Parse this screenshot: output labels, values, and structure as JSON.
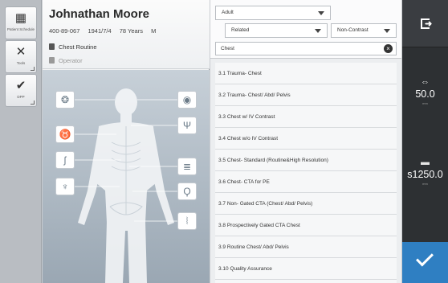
{
  "rail": {
    "items": [
      {
        "label": "Patient Schedule"
      },
      {
        "label": "Tools"
      },
      {
        "label": "DPP"
      }
    ]
  },
  "patient": {
    "name": "Johnathan Moore",
    "id": "400-89-067",
    "dob": "1941/7/4",
    "age": "78 Years",
    "sex": "M",
    "exam": "Chest Routine",
    "operator": "Operator"
  },
  "anatomy": {
    "regions": [
      "brain-icon",
      "lungs-icon",
      "abdomen-icon",
      "pelvis-icon",
      "eye-icon",
      "neck-spine-icon",
      "spine-icon",
      "pelvis-joint-icon",
      "leg-icon"
    ]
  },
  "filters": {
    "patient_type": "Adult",
    "relation": "Related",
    "contrast": "Non-Contrast",
    "search_value": "Chest"
  },
  "protocols": [
    "3.1 Trauma- Chest",
    "3.2 Trauma- Chest/ Abd/ Pelvis",
    "3.3 Chest w/ IV Contrast",
    "3.4 Chest w/o IV Contrast",
    "3.5 Chest- Standard (Routine&High Resolution)",
    "3.6 Chest- CTA for PE",
    "3.7 Non- Gated CTA  (Chest/ Abd/ Pelvis)",
    "3.8 Prospectively Gated CTA Chest",
    "3.9 Routine Chest/ Abd/ Pelvis",
    "3.10 Quality Assurance"
  ],
  "right_panel": {
    "metric1_value": "50.0",
    "metric1_unit": "mm",
    "metric2_value": "s1250.0",
    "metric2_unit": "mm"
  },
  "colors": {
    "confirm": "#2f7fc2",
    "right_panel": "#2d3033"
  }
}
